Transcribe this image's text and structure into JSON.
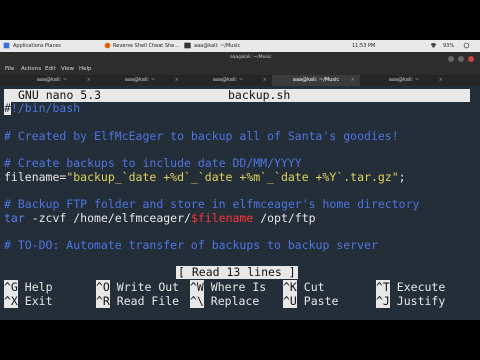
{
  "os_bar": {
    "applications": "Applications",
    "places": "Places",
    "browser_tab": "Reverse Shell Cheat She...",
    "terminal_task": "aaa@kali: ~/Music",
    "clock": "11:53 PM",
    "battery": "93%"
  },
  "window": {
    "title": "aaa@kali: ~/Music"
  },
  "menu": [
    "File",
    "Actions",
    "Edit",
    "View",
    "Help"
  ],
  "tabs": [
    {
      "label": "aaa@kali: ~"
    },
    {
      "label": "aaa@kali: ~"
    },
    {
      "label": "aaa@kali: ~"
    },
    {
      "label": "aaa@kali: ~/Music"
    },
    {
      "label": "aaa@kali: ~"
    }
  ],
  "nano": {
    "version": "GNU nano 5.3",
    "filename": "backup.sh",
    "status": "[ Read 13 lines ]",
    "lines": {
      "l1_cursor": "#",
      "l1_rest": "!/bin/bash",
      "l2": "# Created by ElfMcEager to backup all of Santa's goodies!",
      "l3": "# Create backups to include date DD/MM/YYYY",
      "l4_a": "filename=",
      "l4_b": "\"backup_`date +%d`_`date +%m`_`date +%Y`.tar.gz\"",
      "l4_c": ";",
      "l5": "# Backup FTP folder and store in elfmceager's home directory",
      "l6_a": "tar",
      "l6_b": " -zcvf /home/elfmceager/",
      "l6_c": "$filename",
      "l6_d": " /opt/ftp",
      "l7": "# TO-DO: Automate transfer of backups to backup server"
    },
    "shortcuts": [
      {
        "key": "^G",
        "label": "Help"
      },
      {
        "key": "^O",
        "label": "Write Out"
      },
      {
        "key": "^W",
        "label": "Where Is"
      },
      {
        "key": "^K",
        "label": "Cut"
      },
      {
        "key": "^T",
        "label": "Execute"
      },
      {
        "key": "^X",
        "label": "Exit"
      },
      {
        "key": "^R",
        "label": "Read File"
      },
      {
        "key": "^\\",
        "label": "Replace"
      },
      {
        "key": "^U",
        "label": "Paste"
      },
      {
        "key": "^J",
        "label": "Justify"
      }
    ]
  },
  "colors": {
    "terminal_bg": "#242e38",
    "comment": "#4f74e3",
    "string": "#e2d35a",
    "variable": "#ff3333"
  }
}
